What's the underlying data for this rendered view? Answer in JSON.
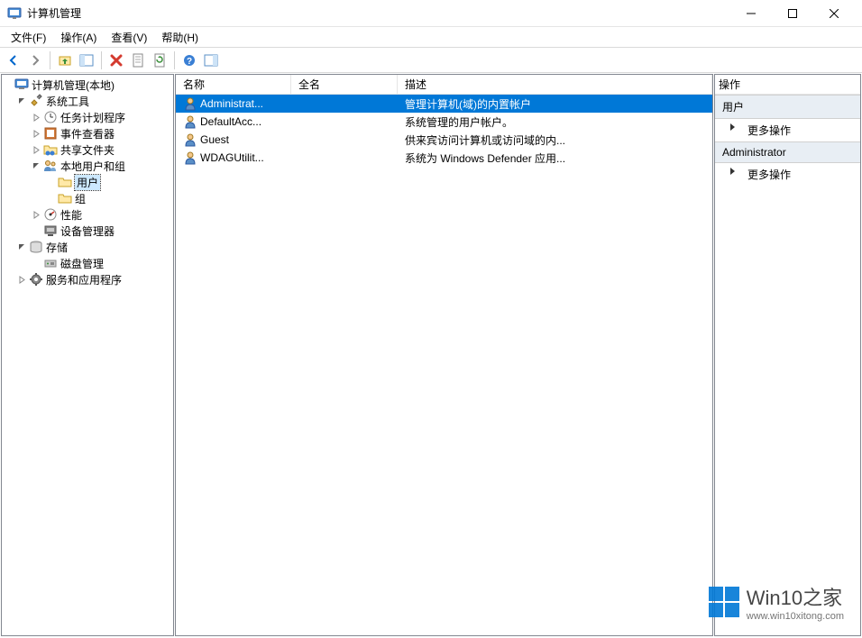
{
  "window": {
    "title": "计算机管理"
  },
  "menu": {
    "file": "文件(F)",
    "action": "操作(A)",
    "view": "查看(V)",
    "help": "帮助(H)"
  },
  "tree": {
    "root": "计算机管理(本地)",
    "system_tools": "系统工具",
    "task_scheduler": "任务计划程序",
    "event_viewer": "事件查看器",
    "shared_folders": "共享文件夹",
    "local_users_groups": "本地用户和组",
    "users": "用户",
    "groups": "组",
    "performance": "性能",
    "device_manager": "设备管理器",
    "storage": "存储",
    "disk_management": "磁盘管理",
    "services_apps": "服务和应用程序"
  },
  "list": {
    "columns": {
      "name": "名称",
      "full_name": "全名",
      "description": "描述"
    },
    "rows": [
      {
        "name": "Administrat...",
        "full_name": "",
        "description": "管理计算机(域)的内置帐户",
        "selected": true
      },
      {
        "name": "DefaultAcc...",
        "full_name": "",
        "description": "系统管理的用户帐户。",
        "selected": false
      },
      {
        "name": "Guest",
        "full_name": "",
        "description": "供来宾访问计算机或访问域的内...",
        "selected": false
      },
      {
        "name": "WDAGUtilit...",
        "full_name": "",
        "description": "系统为 Windows Defender 应用...",
        "selected": false
      }
    ]
  },
  "actions": {
    "title": "操作",
    "group1": "用户",
    "more_actions1": "更多操作",
    "group2": "Administrator",
    "more_actions2": "更多操作"
  },
  "watermark": {
    "line1": "Win10之家",
    "line2": "www.win10xitong.com"
  }
}
